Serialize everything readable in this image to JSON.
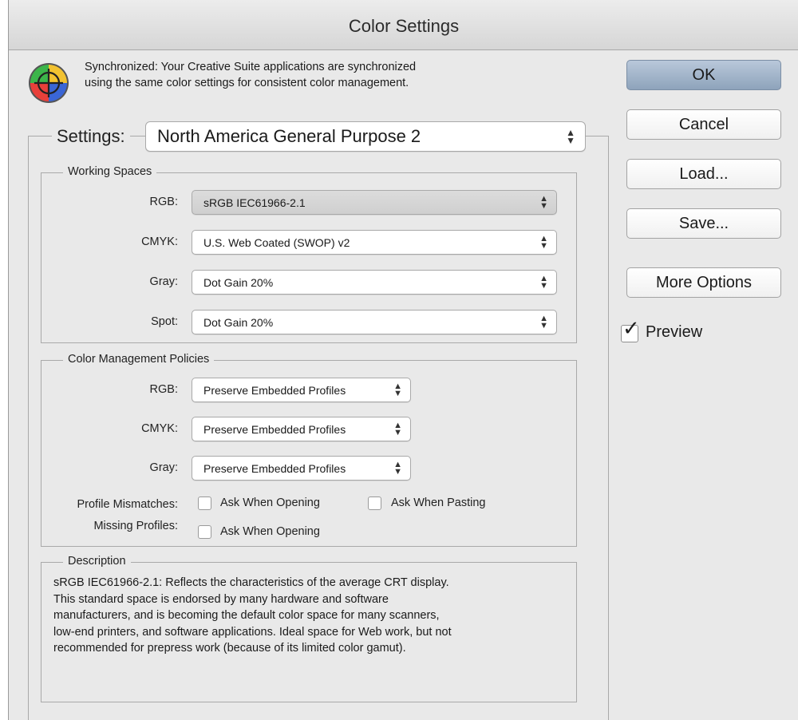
{
  "window": {
    "title": "Color Settings"
  },
  "sync": {
    "icon": "color-wheel-icon",
    "line1": "Synchronized: Your Creative Suite applications are synchronized",
    "line2": "using the same color settings for consistent color management."
  },
  "settings": {
    "label": "Settings:",
    "value": "North America General Purpose 2"
  },
  "working_spaces": {
    "title": "Working Spaces",
    "rgb_label": "RGB:",
    "rgb_value": "sRGB IEC61966-2.1",
    "cmyk_label": "CMYK:",
    "cmyk_value": "U.S. Web Coated (SWOP) v2",
    "gray_label": "Gray:",
    "gray_value": "Dot Gain 20%",
    "spot_label": "Spot:",
    "spot_value": "Dot Gain 20%"
  },
  "policies": {
    "title": "Color Management Policies",
    "rgb_label": "RGB:",
    "rgb_value": "Preserve Embedded Profiles",
    "cmyk_label": "CMYK:",
    "cmyk_value": "Preserve Embedded Profiles",
    "gray_label": "Gray:",
    "gray_value": "Preserve Embedded Profiles",
    "mismatch_label": "Profile Mismatches:",
    "ask_opening": "Ask When Opening",
    "ask_pasting": "Ask When Pasting",
    "missing_label": "Missing Profiles:",
    "missing_ask_opening": "Ask When Opening"
  },
  "description": {
    "title": "Description",
    "lines": [
      "sRGB IEC61966-2.1:  Reflects the characteristics of the average CRT display.",
      "This standard space is endorsed by many hardware and software",
      "manufacturers, and is becoming the default color space for many scanners,",
      "low-end printers, and software applications.  Ideal space for Web work, but not",
      "recommended for prepress work (because of its limited color gamut)."
    ]
  },
  "buttons": {
    "ok": "OK",
    "cancel": "Cancel",
    "load": "Load...",
    "save": "Save...",
    "more_options": "More Options"
  },
  "preview": {
    "label": "Preview",
    "checked": true
  }
}
